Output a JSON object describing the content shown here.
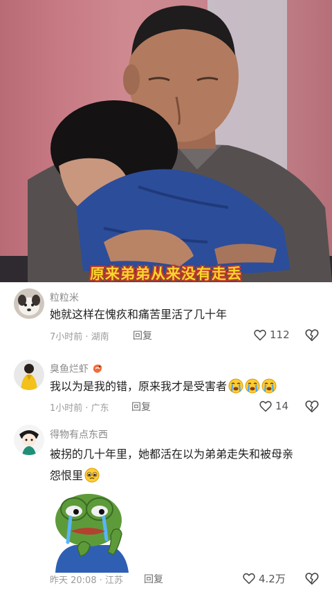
{
  "video": {
    "caption": "原来弟弟从来没有走丢"
  },
  "comments": [
    {
      "username": "粒粒米",
      "text": "她就这样在愧疚和痛苦里活了几十年",
      "meta": "7小时前 · 湖南",
      "reply_label": "回复",
      "likes": "112",
      "avatar_icon": "dog-avatar-icon"
    },
    {
      "username": "臭鱼烂虾",
      "text": "我以为是我的错，原来我才是受害者",
      "emojis": [
        "crying-face-icon",
        "crying-face-icon",
        "crying-face-icon"
      ],
      "meta": "1小时前 · 广东",
      "reply_label": "回复",
      "likes": "14",
      "avatar_icon": "yellow-coat-avatar-icon",
      "badge_icon": "shrimp-badge-icon"
    },
    {
      "username": "得物有点东西",
      "text_line1": "被拐的几十年里，她都活在以为弟弟走失和被母亲",
      "text_line2": "怨恨里",
      "emoji": "pleading-face-icon",
      "sticker": "crying-frog-sticker",
      "meta": "昨天 20:08 · 江苏",
      "reply_label": "回复",
      "likes": "4.2万",
      "avatar_icon": "cartoon-avatar-icon"
    }
  ],
  "colors": {
    "caption_text": "#f7d72a",
    "caption_outline": "#c0392b",
    "secondary_text": "#8a8a8a"
  }
}
